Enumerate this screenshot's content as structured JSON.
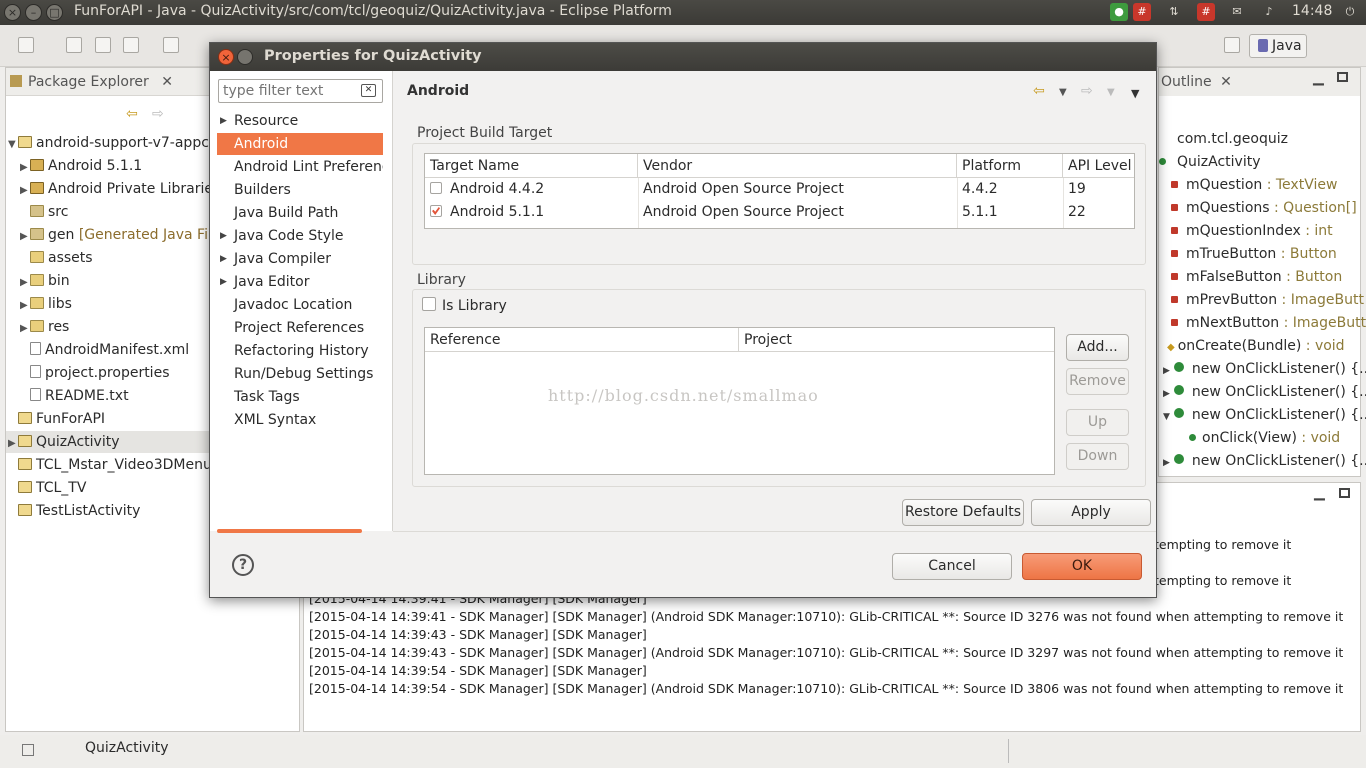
{
  "window_title": "FunForAPI - Java - QuizActivity/src/com/tcl/geoquiz/QuizActivity.java - Eclipse Platform",
  "clock": "14:48",
  "perspective": "Java",
  "package_explorer": {
    "tab_label": "Package Explorer",
    "items": [
      {
        "label": "android-support-v7-appco",
        "extra": ""
      },
      {
        "label": "Android 5.1.1",
        "extra": ""
      },
      {
        "label": "Android Private Librarie",
        "extra": ""
      },
      {
        "label": "src",
        "extra": ""
      },
      {
        "label": "gen",
        "extra": "[Generated Java File"
      },
      {
        "label": "assets",
        "extra": ""
      },
      {
        "label": "bin",
        "extra": ""
      },
      {
        "label": "libs",
        "extra": ""
      },
      {
        "label": "res",
        "extra": ""
      },
      {
        "label": "AndroidManifest.xml",
        "extra": ""
      },
      {
        "label": "project.properties",
        "extra": ""
      },
      {
        "label": "README.txt",
        "extra": ""
      },
      {
        "label": "FunForAPI",
        "extra": ""
      },
      {
        "label": "QuizActivity",
        "extra": ""
      },
      {
        "label": "TCL_Mstar_Video3DMenu",
        "extra": ""
      },
      {
        "label": "TCL_TV",
        "extra": ""
      },
      {
        "label": "TestListActivity",
        "extra": ""
      }
    ]
  },
  "outline": {
    "tab_label": "Outline",
    "items": [
      {
        "name": "com.tcl.geoquiz",
        "type": ""
      },
      {
        "name": "QuizActivity",
        "type": ""
      },
      {
        "name": "mQuestion",
        "type": " : TextView"
      },
      {
        "name": "mQuestions",
        "type": " : Question[]"
      },
      {
        "name": "mQuestionIndex",
        "type": " : int"
      },
      {
        "name": "mTrueButton",
        "type": " : Button"
      },
      {
        "name": "mFalseButton",
        "type": " : Button"
      },
      {
        "name": "mPrevButton",
        "type": " : ImageButt"
      },
      {
        "name": "mNextButton",
        "type": " : ImageButt"
      },
      {
        "name": "onCreate(Bundle)",
        "type": " : void"
      },
      {
        "name": "new OnClickListener() {...",
        "type": ""
      },
      {
        "name": "new OnClickListener() {...",
        "type": ""
      },
      {
        "name": "new OnClickListener() {...",
        "type": ""
      },
      {
        "name": "onClick(View)",
        "type": " : void"
      },
      {
        "name": "new OnClickListener() {...",
        "type": ""
      }
    ]
  },
  "console": {
    "lines": [
      "tempting to remove it",
      "tempting to remove it",
      "[2015-04-14 14:39:41 - SDK Manager] [SDK Manager]",
      "[2015-04-14 14:39:41 - SDK Manager] [SDK Manager] (Android SDK Manager:10710): GLib-CRITICAL **: Source ID 3276 was not found when attempting to remove it",
      "[2015-04-14 14:39:43 - SDK Manager] [SDK Manager]",
      "[2015-04-14 14:39:43 - SDK Manager] [SDK Manager] (Android SDK Manager:10710): GLib-CRITICAL **: Source ID 3297 was not found when attempting to remove it",
      "[2015-04-14 14:39:54 - SDK Manager] [SDK Manager]",
      "[2015-04-14 14:39:54 - SDK Manager] [SDK Manager] (Android SDK Manager:10710): GLib-CRITICAL **: Source ID 3806 was not found when attempting to remove it"
    ]
  },
  "status_text": "QuizActivity",
  "dialog": {
    "title": "Properties for QuizActivity",
    "filter_placeholder": "type filter text",
    "nav_items": [
      {
        "label": "Resource",
        "arrow": "▶"
      },
      {
        "label": "Android",
        "arrow": ""
      },
      {
        "label": "Android Lint Preferences",
        "arrow": ""
      },
      {
        "label": "Builders",
        "arrow": ""
      },
      {
        "label": "Java Build Path",
        "arrow": ""
      },
      {
        "label": "Java Code Style",
        "arrow": "▶"
      },
      {
        "label": "Java Compiler",
        "arrow": "▶"
      },
      {
        "label": "Java Editor",
        "arrow": "▶"
      },
      {
        "label": "Javadoc Location",
        "arrow": ""
      },
      {
        "label": "Project References",
        "arrow": ""
      },
      {
        "label": "Refactoring History",
        "arrow": ""
      },
      {
        "label": "Run/Debug Settings",
        "arrow": ""
      },
      {
        "label": "Task Tags",
        "arrow": ""
      },
      {
        "label": "XML Syntax",
        "arrow": ""
      }
    ],
    "selected_nav": "Android",
    "page_title": "Android",
    "build_target": {
      "group_label": "Project Build Target",
      "columns": [
        "Target Name",
        "Vendor",
        "Platform",
        "API Level"
      ],
      "rows": [
        {
          "checked": false,
          "name": "Android 4.4.2",
          "vendor": "Android Open Source Project",
          "platform": "4.4.2",
          "api": "19"
        },
        {
          "checked": true,
          "name": "Android 5.1.1",
          "vendor": "Android Open Source Project",
          "platform": "5.1.1",
          "api": "22"
        }
      ]
    },
    "library": {
      "group_label": "Library",
      "is_library_label": "Is Library",
      "is_library_checked": false,
      "columns": [
        "Reference",
        "Project"
      ],
      "watermark": "http://blog.csdn.net/smallmao",
      "buttons": {
        "add": "Add...",
        "remove": "Remove",
        "up": "Up",
        "down": "Down"
      }
    },
    "restore_defaults": "Restore Defaults",
    "apply": "Apply",
    "cancel": "Cancel",
    "ok": "OK",
    "help": "?"
  },
  "colors": {
    "accent": "#f07746",
    "ok_button": "#ee7545",
    "title_bar": "#3c3b37"
  }
}
